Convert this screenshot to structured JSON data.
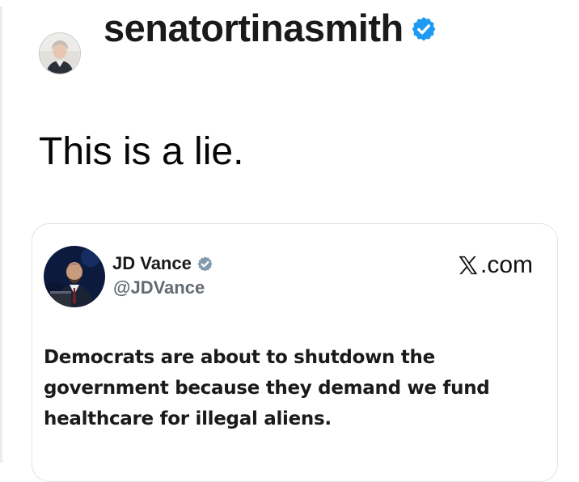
{
  "post": {
    "author_username": "senatortinasmith",
    "author_verified": true,
    "text": "This is a lie."
  },
  "quoted_post": {
    "display_name": "JD Vance",
    "handle": "@JDVance",
    "verified": true,
    "source_label": ".com",
    "source_logo": "x-logo-icon",
    "text_lines": [
      "Democrats are about to shutdown the",
      "government because they demand we fund",
      "healthcare for illegal aliens."
    ]
  },
  "colors": {
    "verified_badge": "#1d9bf0",
    "quoted_verified_badge": "#829aab",
    "handle_text": "#636a70",
    "card_border": "#e3e3e3"
  }
}
